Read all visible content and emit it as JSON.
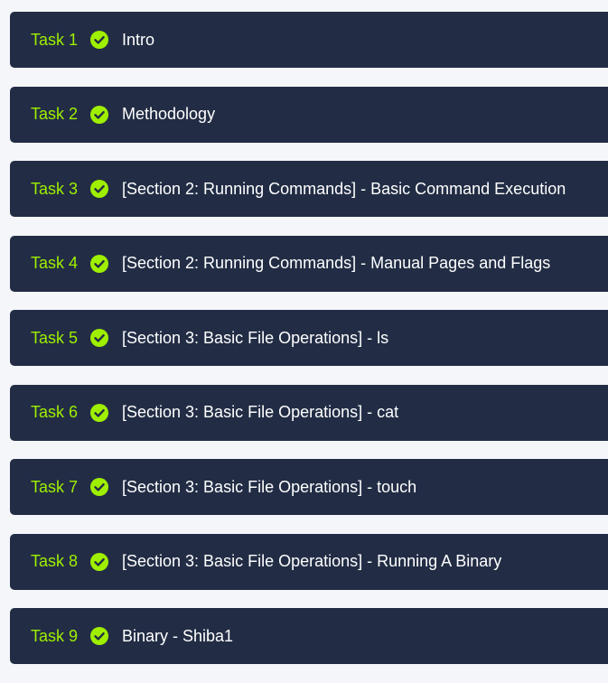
{
  "colors": {
    "page_background": "#f5f6fa",
    "card_background": "#222d45",
    "task_number": "#9fef00",
    "check_fill": "#9fef00",
    "check_mark": "#222d45",
    "title_text": "#ffffff"
  },
  "tasks": [
    {
      "number": "Task 1",
      "title": "Intro",
      "status_icon": "check-circle-icon",
      "completed": true
    },
    {
      "number": "Task 2",
      "title": "Methodology",
      "status_icon": "check-circle-icon",
      "completed": true
    },
    {
      "number": "Task 3",
      "title": "[Section 2: Running Commands] - Basic Command Execution",
      "status_icon": "check-circle-icon",
      "completed": true
    },
    {
      "number": "Task 4",
      "title": "[Section 2: Running Commands] - Manual Pages and Flags",
      "status_icon": "check-circle-icon",
      "completed": true
    },
    {
      "number": "Task 5",
      "title": "[Section 3: Basic File Operations] - ls",
      "status_icon": "check-circle-icon",
      "completed": true
    },
    {
      "number": "Task 6",
      "title": "[Section 3: Basic File Operations] - cat",
      "status_icon": "check-circle-icon",
      "completed": true
    },
    {
      "number": "Task 7",
      "title": "[Section 3: Basic File Operations] - touch",
      "status_icon": "check-circle-icon",
      "completed": true
    },
    {
      "number": "Task 8",
      "title": "[Section 3: Basic File Operations] - Running A Binary",
      "status_icon": "check-circle-icon",
      "completed": true
    },
    {
      "number": "Task 9",
      "title": "Binary - Shiba1",
      "status_icon": "check-circle-icon",
      "completed": true
    }
  ]
}
